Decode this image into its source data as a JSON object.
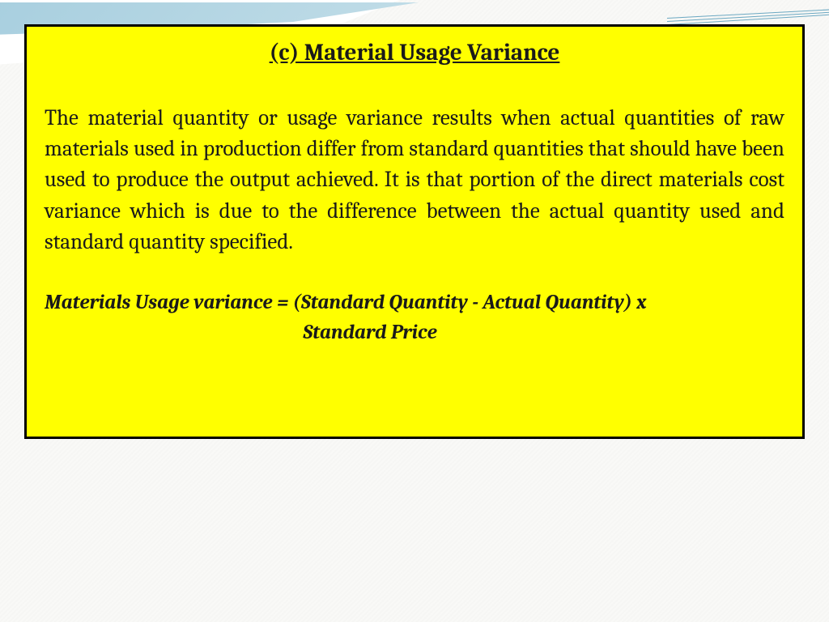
{
  "slide": {
    "heading": "(c) Material Usage Variance",
    "body": "The material quantity or usage variance results when actual quantities of raw materials used in production differ from standard quantities that should have been used to produce the output achieved. It is that portion of the direct materials cost variance which is due to the difference between the actual quantity used and standard quantity specified.",
    "formula_line1": "Materials Usage variance = (Standard Quantity - Actual Quantity) x",
    "formula_line2": "Standard Price"
  },
  "theme": {
    "box_bg": "#ffff00",
    "box_border": "#000000",
    "swoosh_color": "#7fb8d0",
    "page_bg": "#f9f9f7"
  }
}
